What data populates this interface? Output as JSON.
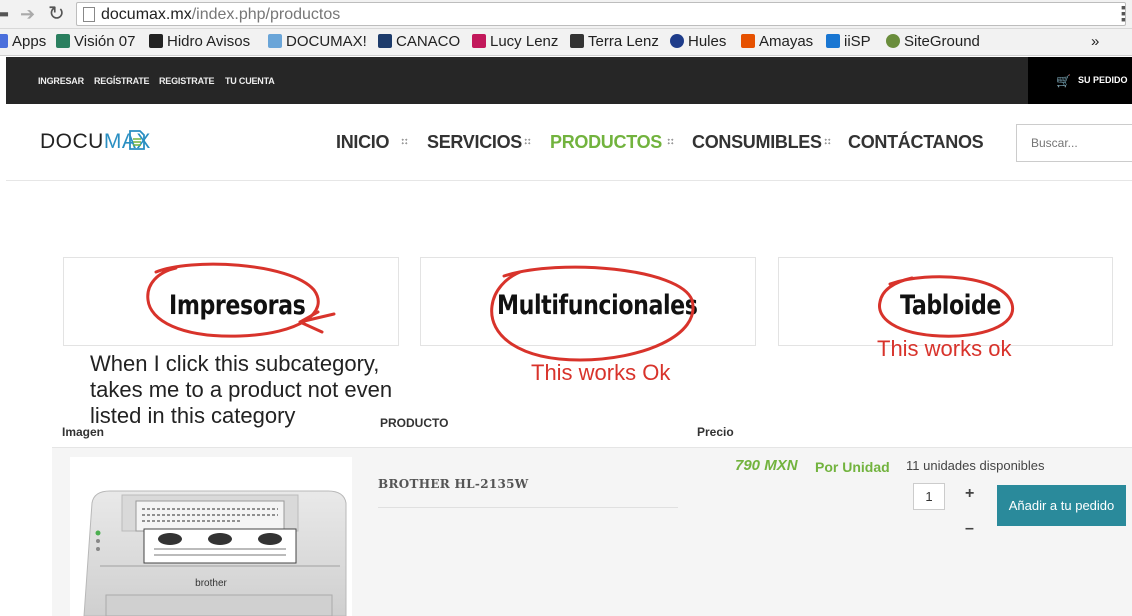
{
  "browser": {
    "url_host": "documax.mx",
    "url_path": "/index.php/productos",
    "bookmarks": [
      {
        "label": "Apps",
        "color": "#4a6fdc"
      },
      {
        "label": "Visión 07",
        "color": "#2a7f5f"
      },
      {
        "label": "Hidro Avisos",
        "color": "#222222"
      },
      {
        "label": "DOCUMAX!",
        "color": "#6aa5d8"
      },
      {
        "label": "CANACO",
        "color": "#1d3b6b"
      },
      {
        "label": "Lucy Lenz",
        "color": "#c2185b"
      },
      {
        "label": "Terra Lenz",
        "color": "#333333"
      },
      {
        "label": "Hules",
        "color": "#1e3c8a"
      },
      {
        "label": "Amayas",
        "color": "#e65100"
      },
      {
        "label": "iiSP",
        "color": "#1976d2"
      },
      {
        "label": "SiteGround",
        "color": "#6a8d3c"
      }
    ],
    "bookmarks_more": "»"
  },
  "site": {
    "top_links": [
      "INGRESAR",
      "REGÍSTRATE",
      "REGISTRATE",
      "TU CUENTA"
    ],
    "cart_label": "SU PEDIDO",
    "logo_part1": "DOCU",
    "logo_part2": "MAX",
    "nav": [
      "INICIO",
      "SERVICIOS",
      "PRODUCTOS",
      "CONSUMIBLES",
      "CONTÁCTANOS"
    ],
    "nav_active": "PRODUCTOS",
    "search_placeholder": "Buscar...",
    "brand_green": "#72b33e",
    "brand_blue": "#2a8fc2"
  },
  "categories": [
    "Impresoras",
    "Multifuncionales",
    "Tabloide"
  ],
  "annotations": {
    "impresoras_note": [
      "When I click this subcategory,",
      "takes me to a product not even",
      "listed in this category"
    ],
    "multi_note": "This works Ok",
    "tabloide_note": "This works ok",
    "annotation_color": "#d8332b"
  },
  "table": {
    "headers": {
      "image": "Imagen",
      "product": "PRODUCTO",
      "price": "Precio"
    },
    "product": {
      "name": "BROTHER HL-2135W",
      "price": "790 MXN",
      "unit": "Por Unidad",
      "stock": "11 unidades disponibles",
      "quantity": "1",
      "plus": "+",
      "minus": "–",
      "add_button": "Añadir a tu pedido",
      "printer_brand": "brother"
    }
  }
}
